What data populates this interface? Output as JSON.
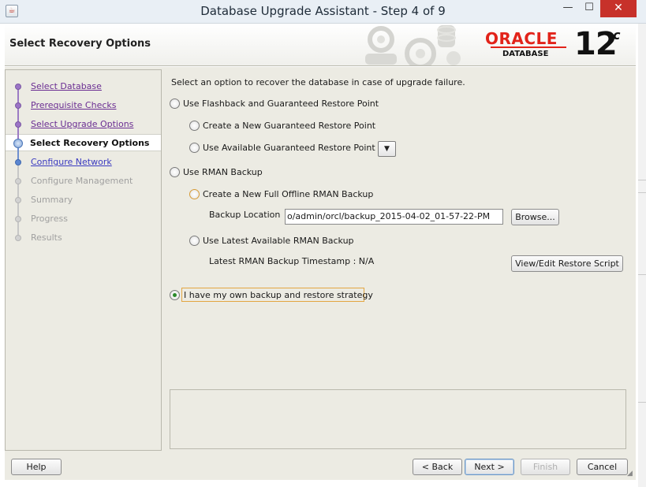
{
  "window": {
    "title": "Database Upgrade Assistant - Step 4 of 9",
    "minimize_glyph": "—",
    "maximize_glyph": "☐",
    "close_glyph": "✕",
    "app_icon": "java-coffee-icon"
  },
  "header": {
    "step_title": "Select Recovery Options",
    "logo_text": "ORACLE",
    "logo_sub": "DATABASE",
    "version": "12",
    "version_suffix": "c"
  },
  "nav": {
    "items": [
      {
        "label": "Select Database",
        "state": "visited"
      },
      {
        "label": "Prerequisite Checks",
        "state": "visited"
      },
      {
        "label": "Select Upgrade Options",
        "state": "visited"
      },
      {
        "label": "Select Recovery Options",
        "state": "current"
      },
      {
        "label": "Configure Network",
        "state": "link"
      },
      {
        "label": "Configure Management",
        "state": "disabled"
      },
      {
        "label": "Summary",
        "state": "disabled"
      },
      {
        "label": "Progress",
        "state": "disabled"
      },
      {
        "label": "Results",
        "state": "disabled"
      }
    ]
  },
  "main": {
    "instruction": "Select an option to recover the database in case of upgrade failure.",
    "opt_flashback": "Use Flashback and Guaranteed Restore Point",
    "opt_create_grp": "Create a New Guaranteed Restore Point",
    "opt_use_grp": "Use Available Guaranteed Restore Point",
    "combo_arrow": "▼",
    "opt_rman": "Use RMAN Backup",
    "opt_full_backup": "Create a New Full Offline RMAN Backup",
    "backup_location_label": "Backup Location",
    "backup_location_value": "o/admin/orcl/backup_2015-04-02_01-57-22-PM",
    "browse_button": "Browse...",
    "opt_latest_rman": "Use Latest Available RMAN Backup",
    "latest_timestamp": "Latest RMAN Backup Timestamp : N/A",
    "view_edit_button": "View/Edit Restore Script",
    "opt_own": "I have my own backup and restore strategy",
    "selected_option": "opt_own"
  },
  "footer": {
    "help": "Help",
    "back": "< Back",
    "next": "Next >",
    "finish": "Finish",
    "cancel": "Cancel"
  },
  "colors": {
    "accent_oracle_red": "#e2231a",
    "panel_bg": "#ecebe3",
    "nav_visited": "#6a2d92",
    "nav_link": "#3a3ac0",
    "close_red": "#c7312a"
  }
}
